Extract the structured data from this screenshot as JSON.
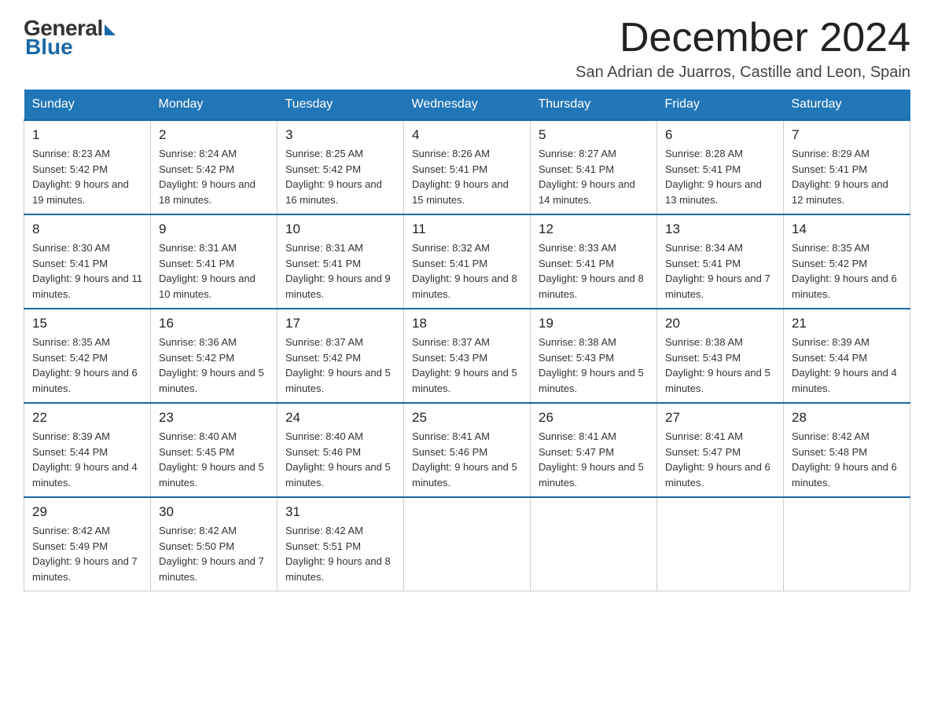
{
  "header": {
    "logo": {
      "general": "General",
      "blue": "Blue"
    },
    "title": "December 2024",
    "subtitle": "San Adrian de Juarros, Castille and Leon, Spain"
  },
  "days_of_week": [
    "Sunday",
    "Monday",
    "Tuesday",
    "Wednesday",
    "Thursday",
    "Friday",
    "Saturday"
  ],
  "weeks": [
    [
      {
        "day": "1",
        "sunrise": "8:23 AM",
        "sunset": "5:42 PM",
        "daylight": "9 hours and 19 minutes."
      },
      {
        "day": "2",
        "sunrise": "8:24 AM",
        "sunset": "5:42 PM",
        "daylight": "9 hours and 18 minutes."
      },
      {
        "day": "3",
        "sunrise": "8:25 AM",
        "sunset": "5:42 PM",
        "daylight": "9 hours and 16 minutes."
      },
      {
        "day": "4",
        "sunrise": "8:26 AM",
        "sunset": "5:41 PM",
        "daylight": "9 hours and 15 minutes."
      },
      {
        "day": "5",
        "sunrise": "8:27 AM",
        "sunset": "5:41 PM",
        "daylight": "9 hours and 14 minutes."
      },
      {
        "day": "6",
        "sunrise": "8:28 AM",
        "sunset": "5:41 PM",
        "daylight": "9 hours and 13 minutes."
      },
      {
        "day": "7",
        "sunrise": "8:29 AM",
        "sunset": "5:41 PM",
        "daylight": "9 hours and 12 minutes."
      }
    ],
    [
      {
        "day": "8",
        "sunrise": "8:30 AM",
        "sunset": "5:41 PM",
        "daylight": "9 hours and 11 minutes."
      },
      {
        "day": "9",
        "sunrise": "8:31 AM",
        "sunset": "5:41 PM",
        "daylight": "9 hours and 10 minutes."
      },
      {
        "day": "10",
        "sunrise": "8:31 AM",
        "sunset": "5:41 PM",
        "daylight": "9 hours and 9 minutes."
      },
      {
        "day": "11",
        "sunrise": "8:32 AM",
        "sunset": "5:41 PM",
        "daylight": "9 hours and 8 minutes."
      },
      {
        "day": "12",
        "sunrise": "8:33 AM",
        "sunset": "5:41 PM",
        "daylight": "9 hours and 8 minutes."
      },
      {
        "day": "13",
        "sunrise": "8:34 AM",
        "sunset": "5:41 PM",
        "daylight": "9 hours and 7 minutes."
      },
      {
        "day": "14",
        "sunrise": "8:35 AM",
        "sunset": "5:42 PM",
        "daylight": "9 hours and 6 minutes."
      }
    ],
    [
      {
        "day": "15",
        "sunrise": "8:35 AM",
        "sunset": "5:42 PM",
        "daylight": "9 hours and 6 minutes."
      },
      {
        "day": "16",
        "sunrise": "8:36 AM",
        "sunset": "5:42 PM",
        "daylight": "9 hours and 5 minutes."
      },
      {
        "day": "17",
        "sunrise": "8:37 AM",
        "sunset": "5:42 PM",
        "daylight": "9 hours and 5 minutes."
      },
      {
        "day": "18",
        "sunrise": "8:37 AM",
        "sunset": "5:43 PM",
        "daylight": "9 hours and 5 minutes."
      },
      {
        "day": "19",
        "sunrise": "8:38 AM",
        "sunset": "5:43 PM",
        "daylight": "9 hours and 5 minutes."
      },
      {
        "day": "20",
        "sunrise": "8:38 AM",
        "sunset": "5:43 PM",
        "daylight": "9 hours and 5 minutes."
      },
      {
        "day": "21",
        "sunrise": "8:39 AM",
        "sunset": "5:44 PM",
        "daylight": "9 hours and 4 minutes."
      }
    ],
    [
      {
        "day": "22",
        "sunrise": "8:39 AM",
        "sunset": "5:44 PM",
        "daylight": "9 hours and 4 minutes."
      },
      {
        "day": "23",
        "sunrise": "8:40 AM",
        "sunset": "5:45 PM",
        "daylight": "9 hours and 5 minutes."
      },
      {
        "day": "24",
        "sunrise": "8:40 AM",
        "sunset": "5:46 PM",
        "daylight": "9 hours and 5 minutes."
      },
      {
        "day": "25",
        "sunrise": "8:41 AM",
        "sunset": "5:46 PM",
        "daylight": "9 hours and 5 minutes."
      },
      {
        "day": "26",
        "sunrise": "8:41 AM",
        "sunset": "5:47 PM",
        "daylight": "9 hours and 5 minutes."
      },
      {
        "day": "27",
        "sunrise": "8:41 AM",
        "sunset": "5:47 PM",
        "daylight": "9 hours and 6 minutes."
      },
      {
        "day": "28",
        "sunrise": "8:42 AM",
        "sunset": "5:48 PM",
        "daylight": "9 hours and 6 minutes."
      }
    ],
    [
      {
        "day": "29",
        "sunrise": "8:42 AM",
        "sunset": "5:49 PM",
        "daylight": "9 hours and 7 minutes."
      },
      {
        "day": "30",
        "sunrise": "8:42 AM",
        "sunset": "5:50 PM",
        "daylight": "9 hours and 7 minutes."
      },
      {
        "day": "31",
        "sunrise": "8:42 AM",
        "sunset": "5:51 PM",
        "daylight": "9 hours and 8 minutes."
      },
      null,
      null,
      null,
      null
    ]
  ]
}
